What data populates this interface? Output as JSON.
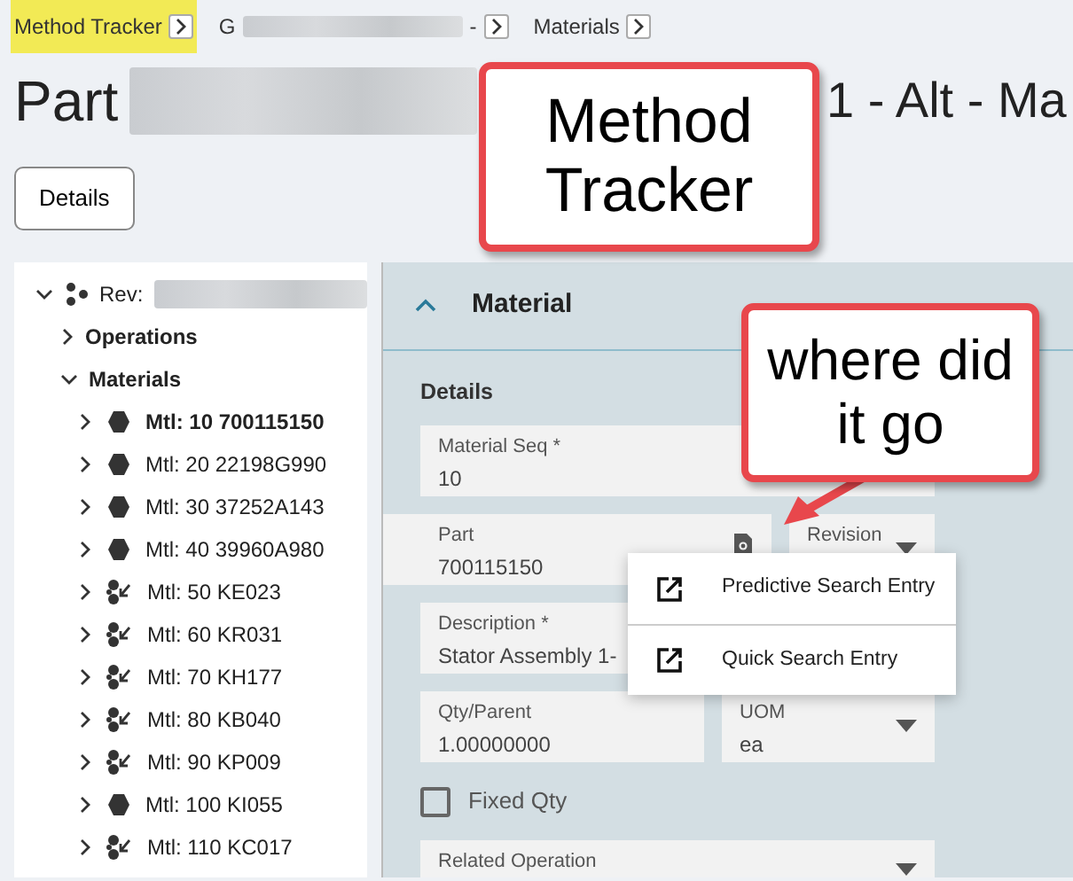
{
  "breadcrumbs": [
    {
      "label": "Method Tracker",
      "highlighted": true
    },
    {
      "label": "G",
      "tail": "-",
      "highlighted": false
    },
    {
      "label": "Materials",
      "highlighted": false
    }
  ],
  "title": {
    "start": "Part",
    "end": "1 - Alt - Ma"
  },
  "details_button": "Details",
  "tree": {
    "label": "Rev:",
    "expanded": true,
    "children": [
      {
        "label": "Operations",
        "expanded": false
      },
      {
        "label": "Materials",
        "expanded": true,
        "children": [
          {
            "label": "Mtl: 10 700115150",
            "kind": "part",
            "expanded": false,
            "selected": true
          },
          {
            "label": "Mtl: 20 22198G990",
            "kind": "part",
            "expanded": false,
            "selected": false
          },
          {
            "label": "Mtl: 30 37252A143",
            "kind": "part",
            "expanded": false,
            "selected": false
          },
          {
            "label": "Mtl: 40 39960A980",
            "kind": "part",
            "expanded": false,
            "selected": false
          },
          {
            "label": "Mtl: 50 KE023",
            "kind": "assembly",
            "expanded": false,
            "selected": false
          },
          {
            "label": "Mtl: 60 KR031",
            "kind": "assembly",
            "expanded": false,
            "selected": false
          },
          {
            "label": "Mtl: 70 KH177",
            "kind": "assembly",
            "expanded": false,
            "selected": false
          },
          {
            "label": "Mtl: 80 KB040",
            "kind": "assembly",
            "expanded": false,
            "selected": false
          },
          {
            "label": "Mtl: 90 KP009",
            "kind": "assembly",
            "expanded": false,
            "selected": false
          },
          {
            "label": "Mtl: 100 KI055",
            "kind": "part",
            "expanded": false,
            "selected": false
          },
          {
            "label": "Mtl: 110 KC017",
            "kind": "assembly",
            "expanded": false,
            "selected": false
          }
        ]
      }
    ]
  },
  "panel": {
    "title": "Material",
    "expanded": true,
    "section": "Details",
    "rows": [
      [
        {
          "kind": "text",
          "label": "Material Seq *",
          "value": "10"
        }
      ],
      [
        {
          "kind": "lookup",
          "label": "Part",
          "value": "700115150",
          "highlighted": true
        },
        {
          "kind": "select",
          "label": "Revision"
        }
      ],
      [
        {
          "kind": "text",
          "label": "Description *",
          "value": "Stator Assembly 1-"
        }
      ],
      [
        {
          "kind": "text",
          "label": "Qty/Parent",
          "value": "1.00000000"
        },
        {
          "kind": "select",
          "label": "UOM",
          "value": "ea"
        }
      ],
      [
        {
          "kind": "checkbox",
          "label": "Fixed Qty",
          "checked": false
        }
      ],
      [
        {
          "kind": "select",
          "label": "Related Operation"
        }
      ]
    ]
  },
  "menu": [
    {
      "label": "Predictive Search Entry"
    },
    {
      "label": "Quick Search Entry"
    }
  ],
  "callouts": [
    {
      "text": "Method Tracker"
    },
    {
      "text": "where did it go"
    }
  ]
}
